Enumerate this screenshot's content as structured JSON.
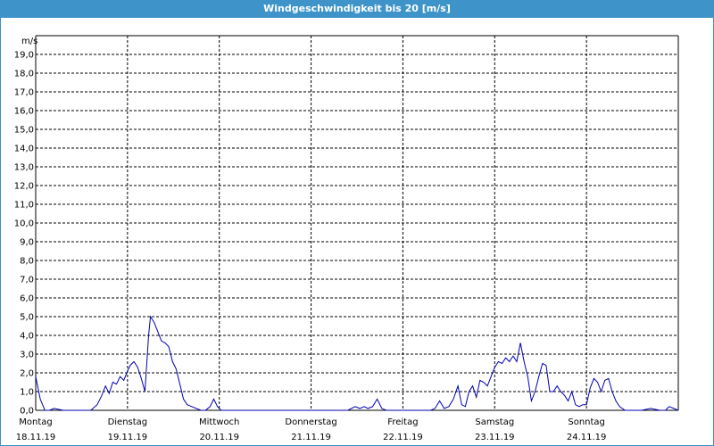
{
  "window": {
    "title": "Windgeschwindigkeit bis 20 [m/s]"
  },
  "chart_data": {
    "type": "line",
    "title": "Windgeschwindigkeit bis 20 [m/s]",
    "ylabel": "m/s",
    "ylim": [
      0,
      20
    ],
    "xlim": [
      0,
      7
    ],
    "grid": true,
    "yticks": [
      "0,0",
      "1,0",
      "2,0",
      "3,0",
      "4,0",
      "5,0",
      "6,0",
      "7,0",
      "8,0",
      "9,0",
      "10,0",
      "11,0",
      "12,0",
      "13,0",
      "14,0",
      "15,0",
      "16,0",
      "17,0",
      "18,0",
      "19,0"
    ],
    "days": [
      {
        "name": "Montag",
        "date": "18.11.19"
      },
      {
        "name": "Dienstag",
        "date": "19.11.19"
      },
      {
        "name": "Mittwoch",
        "date": "20.11.19"
      },
      {
        "name": "Donnerstag",
        "date": "21.11.19"
      },
      {
        "name": "Freitag",
        "date": "22.11.19"
      },
      {
        "name": "Samstag",
        "date": "23.11.19"
      },
      {
        "name": "Sonntag",
        "date": "24.11.19"
      }
    ],
    "colors": {
      "line": "#0000b0",
      "grid": "#000000"
    },
    "series": [
      {
        "points": [
          [
            0.0,
            1.8
          ],
          [
            0.05,
            0.6
          ],
          [
            0.1,
            0.0
          ],
          [
            0.15,
            0.0
          ],
          [
            0.2,
            0.1
          ],
          [
            0.3,
            0.0
          ],
          [
            0.5,
            0.0
          ],
          [
            0.6,
            0.0
          ],
          [
            0.67,
            0.3
          ],
          [
            0.72,
            0.8
          ],
          [
            0.76,
            1.3
          ],
          [
            0.8,
            0.9
          ],
          [
            0.84,
            1.5
          ],
          [
            0.88,
            1.4
          ],
          [
            0.92,
            1.8
          ],
          [
            0.96,
            1.6
          ],
          [
            1.0,
            2.1
          ],
          [
            1.03,
            2.4
          ],
          [
            1.07,
            2.6
          ],
          [
            1.11,
            2.3
          ],
          [
            1.15,
            1.7
          ],
          [
            1.19,
            1.0
          ],
          [
            1.23,
            4.0
          ],
          [
            1.25,
            5.0
          ],
          [
            1.29,
            4.7
          ],
          [
            1.33,
            4.2
          ],
          [
            1.37,
            3.7
          ],
          [
            1.41,
            3.6
          ],
          [
            1.45,
            3.4
          ],
          [
            1.49,
            2.6
          ],
          [
            1.53,
            2.2
          ],
          [
            1.57,
            1.4
          ],
          [
            1.61,
            0.6
          ],
          [
            1.65,
            0.3
          ],
          [
            1.7,
            0.2
          ],
          [
            1.75,
            0.1
          ],
          [
            1.8,
            0.0
          ],
          [
            1.85,
            0.0
          ],
          [
            1.9,
            0.2
          ],
          [
            1.94,
            0.6
          ],
          [
            1.98,
            0.2
          ],
          [
            2.02,
            0.0
          ],
          [
            2.1,
            0.0
          ],
          [
            2.5,
            0.0
          ],
          [
            3.0,
            0.0
          ],
          [
            3.4,
            0.0
          ],
          [
            3.48,
            0.2
          ],
          [
            3.53,
            0.1
          ],
          [
            3.58,
            0.2
          ],
          [
            3.62,
            0.1
          ],
          [
            3.67,
            0.2
          ],
          [
            3.72,
            0.6
          ],
          [
            3.77,
            0.1
          ],
          [
            3.82,
            0.0
          ],
          [
            3.9,
            0.0
          ],
          [
            4.2,
            0.0
          ],
          [
            4.3,
            0.0
          ],
          [
            4.35,
            0.1
          ],
          [
            4.4,
            0.5
          ],
          [
            4.45,
            0.1
          ],
          [
            4.5,
            0.2
          ],
          [
            4.55,
            0.6
          ],
          [
            4.6,
            1.3
          ],
          [
            4.64,
            0.3
          ],
          [
            4.68,
            0.2
          ],
          [
            4.72,
            1.0
          ],
          [
            4.76,
            1.3
          ],
          [
            4.8,
            0.7
          ],
          [
            4.84,
            1.6
          ],
          [
            4.88,
            1.5
          ],
          [
            4.92,
            1.3
          ],
          [
            4.96,
            1.8
          ],
          [
            5.0,
            2.3
          ],
          [
            5.04,
            2.6
          ],
          [
            5.08,
            2.5
          ],
          [
            5.12,
            2.8
          ],
          [
            5.16,
            2.6
          ],
          [
            5.2,
            2.9
          ],
          [
            5.24,
            2.6
          ],
          [
            5.28,
            3.6
          ],
          [
            5.32,
            2.6
          ],
          [
            5.36,
            1.8
          ],
          [
            5.4,
            0.5
          ],
          [
            5.44,
            1.0
          ],
          [
            5.48,
            1.8
          ],
          [
            5.52,
            2.5
          ],
          [
            5.56,
            2.4
          ],
          [
            5.6,
            1.0
          ],
          [
            5.64,
            1.0
          ],
          [
            5.68,
            1.3
          ],
          [
            5.72,
            1.0
          ],
          [
            5.76,
            0.8
          ],
          [
            5.8,
            0.5
          ],
          [
            5.84,
            1.0
          ],
          [
            5.88,
            0.3
          ],
          [
            5.92,
            0.2
          ],
          [
            5.96,
            0.3
          ],
          [
            6.0,
            0.3
          ],
          [
            6.04,
            1.2
          ],
          [
            6.08,
            1.7
          ],
          [
            6.12,
            1.5
          ],
          [
            6.16,
            1.0
          ],
          [
            6.2,
            1.6
          ],
          [
            6.24,
            1.7
          ],
          [
            6.28,
            1.0
          ],
          [
            6.32,
            0.5
          ],
          [
            6.36,
            0.2
          ],
          [
            6.42,
            0.0
          ],
          [
            6.5,
            0.0
          ],
          [
            6.6,
            0.0
          ],
          [
            6.7,
            0.1
          ],
          [
            6.8,
            0.0
          ],
          [
            6.86,
            0.0
          ],
          [
            6.9,
            0.2
          ],
          [
            6.95,
            0.1
          ],
          [
            7.0,
            0.0
          ]
        ]
      }
    ]
  }
}
